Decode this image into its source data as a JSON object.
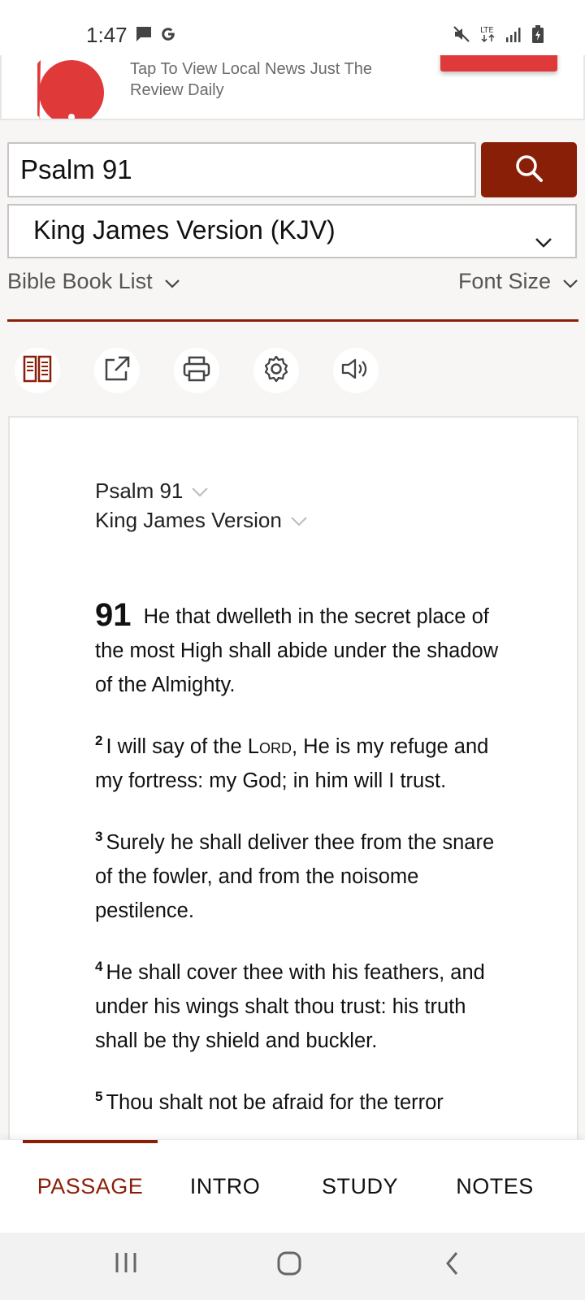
{
  "status_bar": {
    "time": "1:47",
    "icons": [
      "message-icon",
      "google-icon",
      "mute-icon",
      "lte-icon",
      "signal-icon",
      "battery-icon"
    ],
    "network": "LTE"
  },
  "ad": {
    "text": "Tap To View Local News Just The Review Daily",
    "accent_color": "#e0393a"
  },
  "search": {
    "value": "Psalm 91",
    "button_icon": "search-icon"
  },
  "version_select": {
    "selected": "King James Version (KJV)"
  },
  "links": {
    "book_list": "Bible Book List",
    "font_size": "Font Size"
  },
  "toolbar": {
    "icons": [
      "parallel-icon",
      "share-icon",
      "print-icon",
      "settings-icon",
      "audio-icon"
    ]
  },
  "passage": {
    "reference": "Psalm 91",
    "version": "King James Version",
    "chapter": "91",
    "verses": [
      {
        "num": "",
        "text": "He that dwelleth in the secret place of the most High shall abide under the shadow of the Almighty."
      },
      {
        "num": "2",
        "text_before": "I will say of the ",
        "lord": "Lord",
        "text_after": ", He is my refuge and my fortress: my God; in him will I trust."
      },
      {
        "num": "3",
        "text": "Surely he shall deliver thee from the snare of the fowler, and from the noisome pestilence."
      },
      {
        "num": "4",
        "text": "He shall cover thee with his feathers, and under his wings shalt thou trust: his truth shall be thy shield and buckler."
      },
      {
        "num": "5",
        "text": "Thou shalt not be afraid for the terror"
      }
    ]
  },
  "tabs": {
    "passage": "PASSAGE",
    "intro": "INTRO",
    "study": "STUDY",
    "notes": "NOTES"
  },
  "colors": {
    "brand": "#8a1f08",
    "background": "#f7f6f4"
  }
}
